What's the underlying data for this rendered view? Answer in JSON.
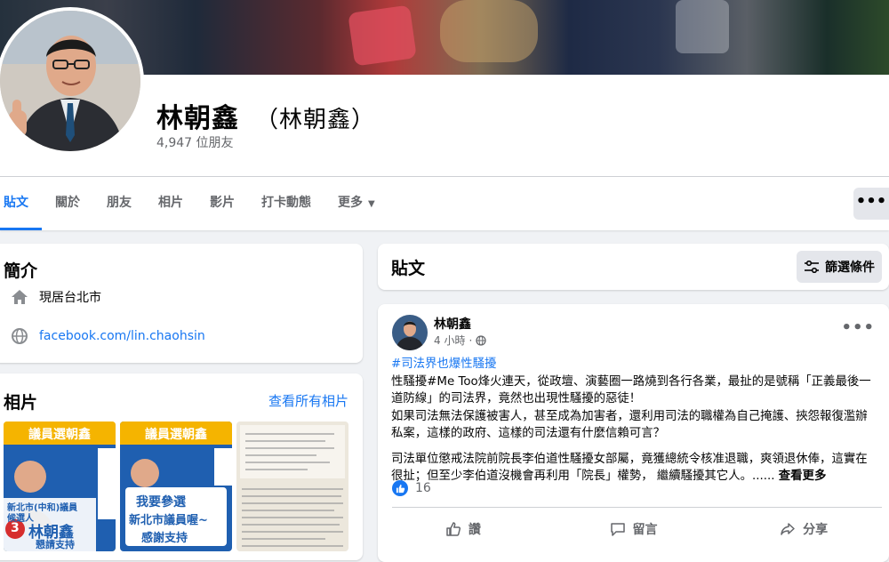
{
  "profile": {
    "name": "林朝鑫",
    "alt_name": "（林朝鑫）",
    "friends": "4,947 位朋友"
  },
  "tabs": [
    {
      "label": "貼文"
    },
    {
      "label": "關於"
    },
    {
      "label": "朋友"
    },
    {
      "label": "相片"
    },
    {
      "label": "影片"
    },
    {
      "label": "打卡動態"
    },
    {
      "label": "更多"
    }
  ],
  "more_menu_icon": "•••",
  "intro": {
    "title": "簡介",
    "city": "現居台北市",
    "link": "facebook.com/lin.chaohsin"
  },
  "photos": {
    "title": "相片",
    "see_all": "查看所有相片",
    "thumbs": [
      {
        "banner": "議員選朝鑫",
        "line1": "新北市(中和)議員",
        "line2": "候選人",
        "number": "3",
        "name": "林朝鑫",
        "slogan": "懇請支持"
      },
      {
        "banner": "議員選朝鑫",
        "line1": "我要參選",
        "line2": "新北市議員喔~",
        "line3": "感謝支持"
      }
    ]
  },
  "posts_header": {
    "title": "貼文",
    "filter": "篩選條件"
  },
  "post": {
    "author": "林朝鑫",
    "time": "4 小時",
    "hashtag": "#司法界也爆性騷擾",
    "para1": "性騷擾#Me Too烽火連天，從政壇、演藝圈一路燒到各行各業，最扯的是號稱「正義最後一道防線」的司法界，竟然也出現性騷擾的惡徒！",
    "para2": "如果司法無法保護被害人，甚至成為加害者，還利用司法的職權為自己掩護、挾怨報復濫辦私案，這樣的政府、這樣的司法還有什麼信賴可言？",
    "para3": "司法單位懲戒法院前院長李伯道性騷擾女部屬，竟獲總統令核准退職，爽領退休俸，這實在很扯；但至少李伯道沒機會再利用「院長」權勢， 繼續騷擾其它人。......",
    "see_more": "查看更多",
    "like_count": "16",
    "actions": {
      "like": "讚",
      "comment": "留言",
      "share": "分享"
    }
  },
  "colors": {
    "accent": "#1877f2",
    "secondary_text": "#65676b",
    "page_bg": "#f0f2f5",
    "card_bg": "#ffffff"
  }
}
